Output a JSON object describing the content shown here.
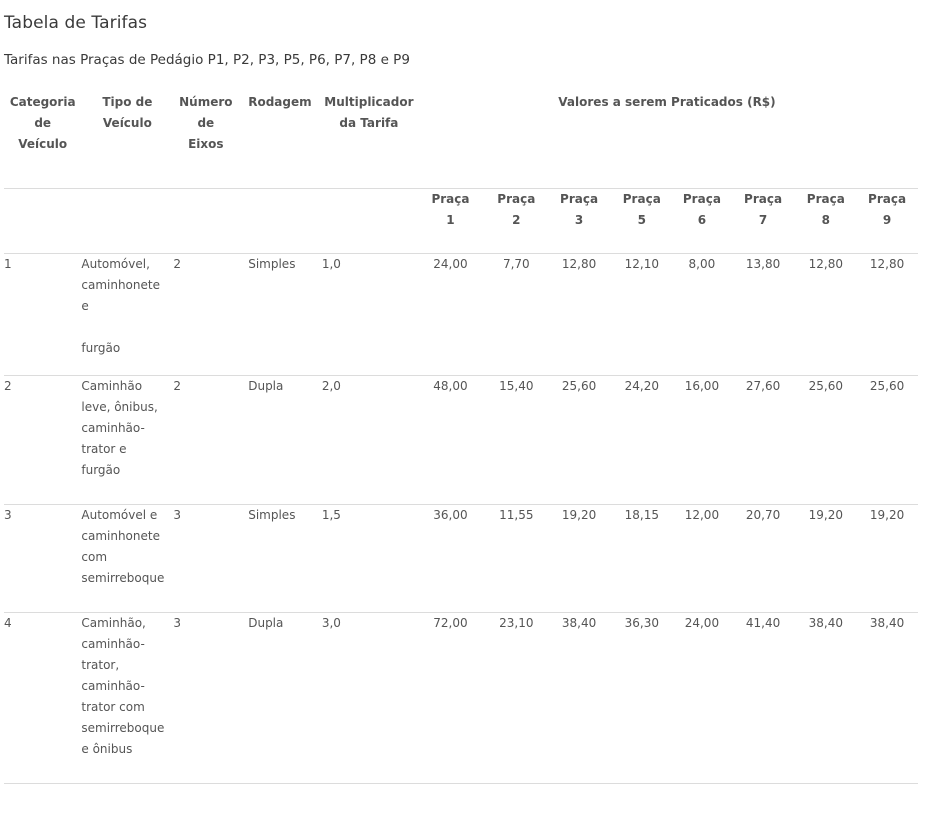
{
  "page": {
    "title": "Tabela  de Tarifas",
    "subtitle": "Tarifas nas Praças de Pedágio P1, P2, P3, P5, P6, P7, P8 e P9"
  },
  "table": {
    "headers": {
      "categoria": [
        "Categoria",
        "de",
        "Veículo"
      ],
      "tipo": [
        "Tipo de",
        "Veículo"
      ],
      "eixos": [
        "Número",
        "de",
        "Eixos"
      ],
      "rodagem": [
        "Rodagem"
      ],
      "multiplicador": [
        "Multiplicador",
        "da Tarifa"
      ],
      "valores": "Valores a serem Praticados (R$)"
    },
    "pracas": [
      [
        "Praça",
        "1"
      ],
      [
        "Praça",
        "2"
      ],
      [
        "Praça",
        "3"
      ],
      [
        "Praça",
        "5"
      ],
      [
        "Praça",
        "6"
      ],
      [
        "Praça",
        "7"
      ],
      [
        "Praça",
        "8"
      ],
      [
        "Praça",
        "9"
      ]
    ],
    "rows": [
      {
        "categoria": "1",
        "tipo": [
          "Automóvel,",
          "caminhonete",
          "e",
          "",
          "furgão"
        ],
        "eixos": "2",
        "rodagem": "Simples",
        "multiplicador": "1,0",
        "valores": [
          "24,00",
          "7,70",
          "12,80",
          "12,10",
          "8,00",
          "13,80",
          "12,80",
          "12,80"
        ]
      },
      {
        "categoria": "2",
        "tipo": [
          "Caminhão",
          "leve, ônibus,",
          "caminhão-",
          "trator e",
          "furgão"
        ],
        "eixos": "2",
        "rodagem": "Dupla",
        "multiplicador": "2,0",
        "valores": [
          "48,00",
          "15,40",
          "25,60",
          "24,20",
          "16,00",
          "27,60",
          "25,60",
          "25,60"
        ]
      },
      {
        "categoria": "3",
        "tipo": [
          "Automóvel e",
          "caminhonete",
          "com",
          "semirreboque"
        ],
        "eixos": "3",
        "rodagem": "Simples",
        "multiplicador": "1,5",
        "valores": [
          "36,00",
          "11,55",
          "19,20",
          "18,15",
          "12,00",
          "20,70",
          "19,20",
          "19,20"
        ]
      },
      {
        "categoria": "4",
        "tipo": [
          "Caminhão,",
          "caminhão-",
          "trator,",
          "caminhão-",
          "trator com",
          "semirreboque",
          "e ônibus"
        ],
        "eixos": "3",
        "rodagem": "Dupla",
        "multiplicador": "3,0",
        "valores": [
          "72,00",
          "23,10",
          "38,40",
          "36,30",
          "24,00",
          "41,40",
          "38,40",
          "38,40"
        ]
      }
    ]
  }
}
